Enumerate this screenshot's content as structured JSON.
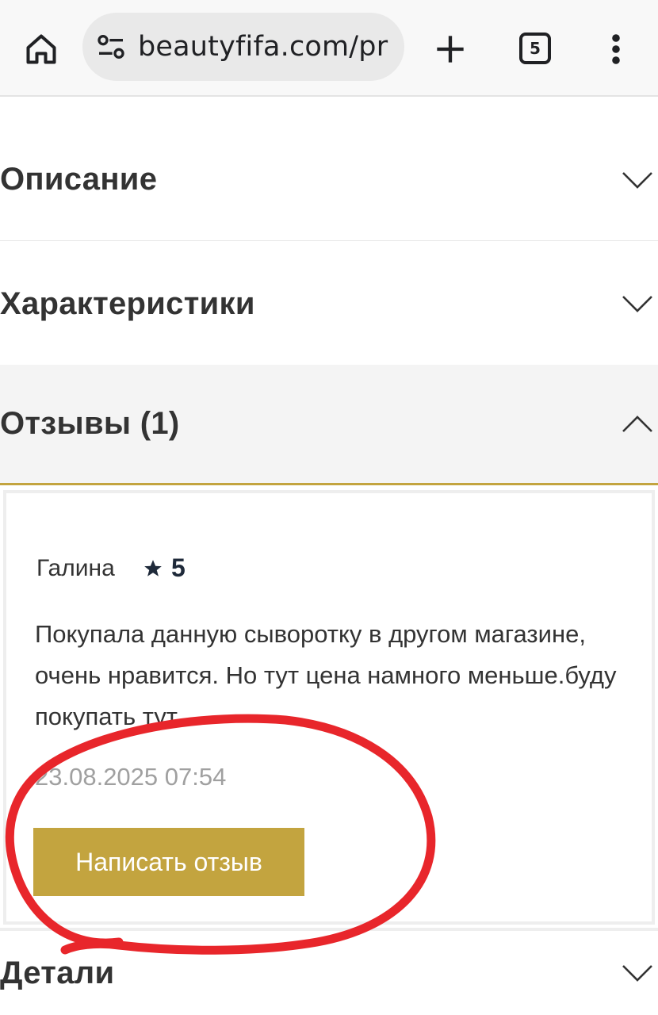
{
  "browser": {
    "url": "beautyfifa.com/pr",
    "tab_count": "5"
  },
  "sections": {
    "description": "Описание",
    "characteristics": "Характеристики",
    "reviews": "Отзывы (1)",
    "details": "Детали"
  },
  "review": {
    "author": "Галина",
    "rating": "5",
    "text": "Покупала данную сыворотку в другом магазине, очень нравится. Но тут цена намного меньше.буду покупать тут.",
    "date": "23.08.2025 07:54"
  },
  "actions": {
    "write_review": "Написать отзыв"
  },
  "colors": {
    "accent": "#c3a43f",
    "annotation": "#e8262b"
  },
  "icons": [
    "home-icon",
    "site-settings-icon",
    "plus-icon",
    "tabs-icon",
    "more-vert-icon",
    "chevron-down-icon",
    "chevron-up-icon",
    "star-icon"
  ]
}
